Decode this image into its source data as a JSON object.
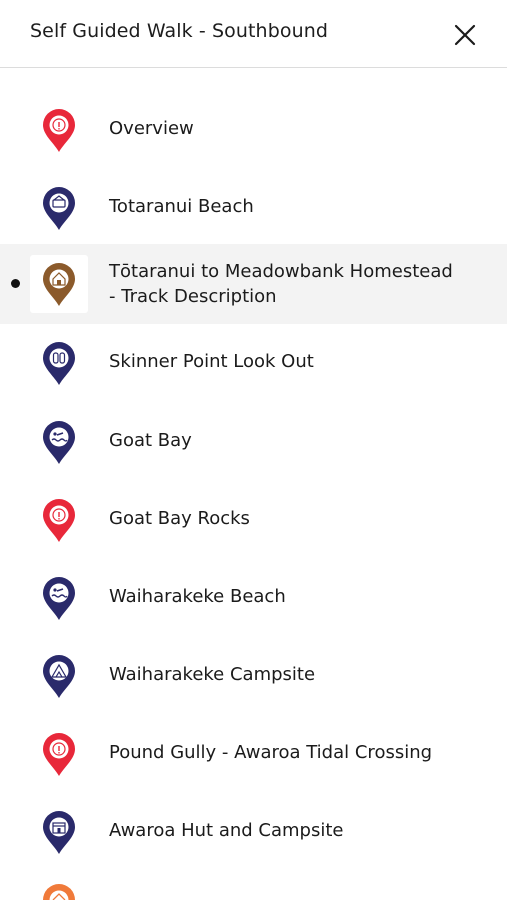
{
  "header": {
    "title": "Self Guided Walk - Southbound",
    "close_icon": "close-icon"
  },
  "colors": {
    "red": "#e8283a",
    "navy": "#2a2a6b",
    "brown": "#8b5a2b",
    "orange": "#f07a3a",
    "active_bg": "#f3f3f3"
  },
  "items": [
    {
      "label": "Overview",
      "icon": "info-pin-icon",
      "color": "red"
    },
    {
      "label": "Totaranui Beach",
      "icon": "beach-pin-icon",
      "color": "navy"
    },
    {
      "label_line1": "Tōtaranui to Meadowbank Homestead",
      "label_line2": "- Track Description",
      "icon": "homestead-pin-icon",
      "color": "brown",
      "active": true
    },
    {
      "label": "Skinner Point Look Out",
      "icon": "lookout-pin-icon",
      "color": "navy"
    },
    {
      "label": "Goat Bay",
      "icon": "swim-pin-icon",
      "color": "navy"
    },
    {
      "label": "Goat Bay Rocks",
      "icon": "info-pin-icon",
      "color": "red"
    },
    {
      "label": "Waiharakeke Beach",
      "icon": "swim-pin-icon",
      "color": "navy"
    },
    {
      "label": "Waiharakeke Campsite",
      "icon": "campsite-pin-icon",
      "color": "navy"
    },
    {
      "label": "Pound Gully - Awaroa Tidal Crossing",
      "icon": "info-pin-icon",
      "color": "red"
    },
    {
      "label": "Awaroa Hut and Campsite",
      "icon": "hut-pin-icon",
      "color": "navy"
    },
    {
      "label": "",
      "icon": "home-pin-icon",
      "color": "orange"
    }
  ]
}
